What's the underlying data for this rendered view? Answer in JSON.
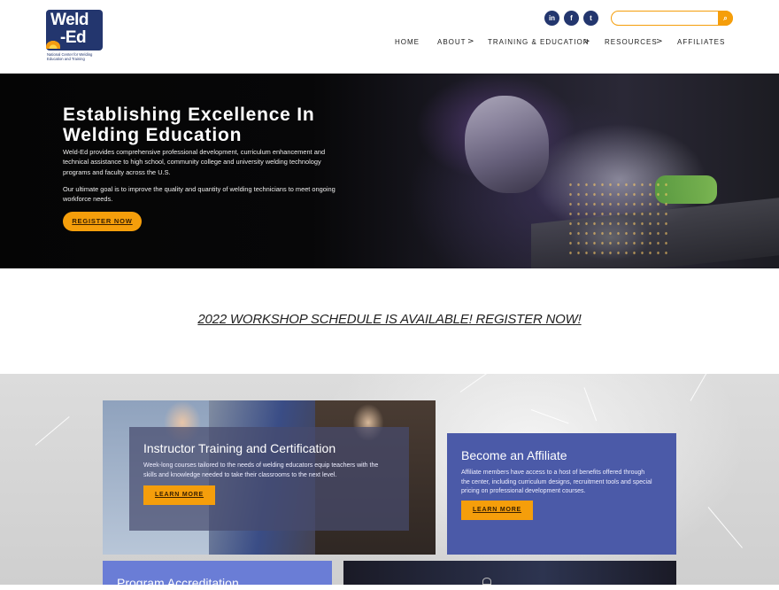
{
  "header": {
    "logo": {
      "line1": "Weld",
      "line2": "-Ed",
      "subtitle": [
        "National Center for Welding",
        "Education and Training"
      ]
    },
    "social": [
      {
        "icon": "linkedin-icon",
        "glyph": "in"
      },
      {
        "icon": "facebook-icon",
        "glyph": "f"
      },
      {
        "icon": "twitter-icon",
        "glyph": "t"
      }
    ],
    "search": {
      "placeholder": "",
      "value": ""
    },
    "nav": {
      "home": "HOME",
      "about": "ABOUT",
      "training": "TRAINING & EDUCATION",
      "resources": "RESOURCES",
      "affiliates": "AFFILIATES",
      "arrow": ">"
    }
  },
  "hero": {
    "title_line1": "Establishing Excellence In",
    "title_line2": "Welding Education",
    "p1_line1": "Weld-Ed provides comprehensive professional development, curriculum enhancement and",
    "p1_line2": "technical assistance to high school, community college and university welding technology",
    "p1_line3": "programs and faculty across the U.S.",
    "p2_line1": "Our ultimate goal is to improve the quality and quantity of welding technicians to meet ongoing",
    "p2_line2": "workforce needs.",
    "button": "REGISTER NOW"
  },
  "announcement": "2022 WORKSHOP SCHEDULE IS AVAILABLE! REGISTER NOW!",
  "cards": {
    "instructor": {
      "title": "Instructor Training and Certification",
      "text_line1": "Week-long courses tailored to the needs of welding educators equip teachers with the",
      "text_line2": "skills and knowledge needed to take their classrooms to the next level.",
      "button": "LEARN MORE"
    },
    "affiliate": {
      "title": "Become an Affiliate",
      "text_line1": "Affiliate members have access to a host of benefits offered through",
      "text_line2": "the center, including curriculum designs, recruitment tools and special",
      "text_line3": "pricing on professional development courses.",
      "button": "LEARN MORE"
    },
    "accreditation": {
      "title": "Program Accreditation"
    }
  },
  "colors": {
    "brand_navy": "#23366e",
    "accent_orange": "#f59e0b",
    "affiliate_blue": "#4b5aa8",
    "accreditation_blue": "#6a7dd6"
  }
}
